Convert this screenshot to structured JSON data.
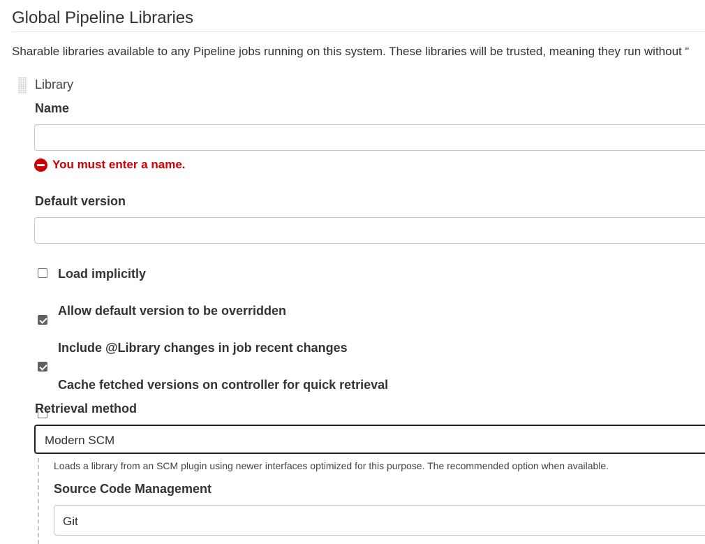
{
  "section": {
    "title": "Global Pipeline Libraries",
    "description": "Sharable libraries available to any Pipeline jobs running on this system. These libraries will be trusted, meaning they run without “"
  },
  "library": {
    "block_title": "Library",
    "name": {
      "label": "Name",
      "value": "",
      "error": "You must enter a name."
    },
    "default_version": {
      "label": "Default version",
      "value": ""
    },
    "options": [
      {
        "label": "Load implicitly",
        "checked": false
      },
      {
        "label": "Allow default version to be overridden",
        "checked": true
      },
      {
        "label": "Include @Library changes in job recent changes",
        "checked": true
      },
      {
        "label": "Cache fetched versions on controller for quick retrieval",
        "checked": false
      }
    ],
    "retrieval": {
      "label": "Retrieval method",
      "selected": "Modern SCM",
      "help": "Loads a library from an SCM plugin using newer interfaces optimized for this purpose. The recommended option when available.",
      "scm_label": "Source Code Management",
      "scm_selected": "Git"
    }
  },
  "colors": {
    "error": "#cc0000",
    "checked": "#606060"
  }
}
